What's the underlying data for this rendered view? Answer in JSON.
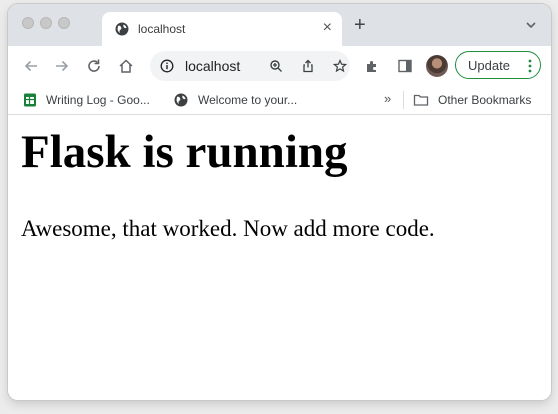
{
  "tab": {
    "title": "localhost",
    "close_label": "×",
    "new_tab_label": "+"
  },
  "omnibox": {
    "url": "localhost"
  },
  "update_button": {
    "label": "Update"
  },
  "bookmarks": {
    "items": [
      {
        "label": "Writing Log - Goo...",
        "icon": "sheets-icon"
      },
      {
        "label": "Welcome to your...",
        "icon": "globe-icon"
      }
    ],
    "overflow_label": "»",
    "other_label": "Other Bookmarks"
  },
  "page": {
    "heading": "Flask is running",
    "paragraph": "Awesome, that worked. Now add more code."
  },
  "colors": {
    "tabstrip": "#dee1e6",
    "update_border": "#1e8e3e",
    "sheets_green": "#188038"
  }
}
